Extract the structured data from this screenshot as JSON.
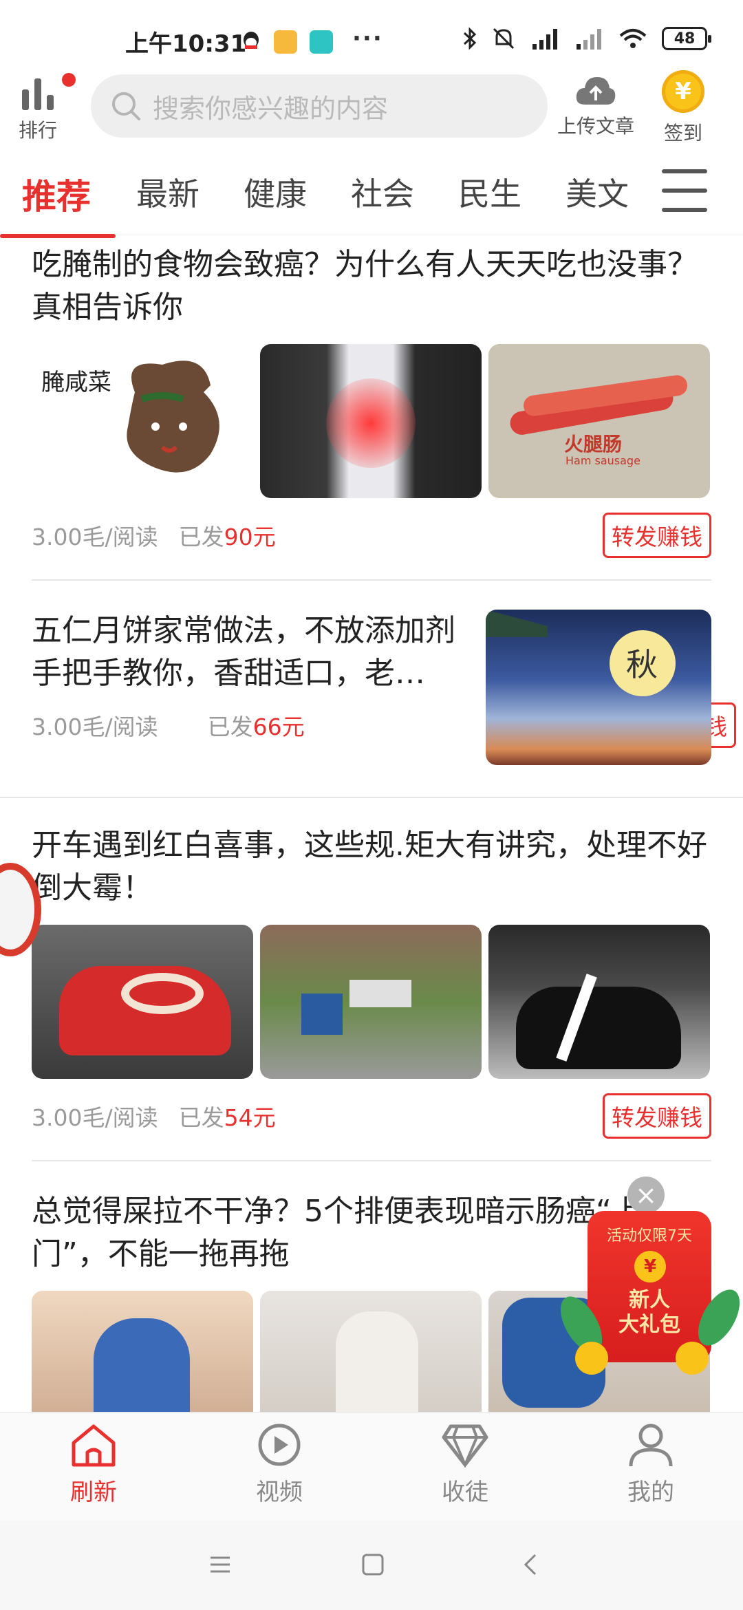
{
  "status_bar": {
    "time": "上午10:31",
    "dots": "···",
    "battery": "48"
  },
  "header": {
    "rank_label": "排行",
    "search_placeholder": "搜索你感兴趣的内容",
    "upload_label": "上传文章",
    "coin_symbol": "¥",
    "sign_label": "签到"
  },
  "tabs": [
    "推荐",
    "最新",
    "健康",
    "社会",
    "民生",
    "美文"
  ],
  "articles": [
    {
      "title": "吃腌制的食物会致癌？为什么有人天天吃也没事？真相告诉你",
      "rate": "3.00毛/阅读",
      "paid_prefix": "已发",
      "paid_amount": "90元",
      "share_label": "转发赚钱",
      "thumb_texts": [
        "腌咸菜",
        "",
        "火腿肠",
        "Ham sausage"
      ]
    },
    {
      "title": "五仁月饼家常做法，不放添加剂手把手教你，香甜适口，老…",
      "rate": "3.00毛/阅读",
      "paid_prefix": "已发",
      "paid_amount": "66元",
      "share_label": "转发赚钱",
      "thumb_texts": [
        "秋"
      ]
    },
    {
      "title": "开车遇到红白喜事，这些规.矩大有讲究，处理不好倒大霉！",
      "rate": "3.00毛/阅读",
      "paid_prefix": "已发",
      "paid_amount": "54元",
      "share_label": "转发赚钱"
    },
    {
      "title": "总觉得屎拉不干净？5个排便表现暗示肠癌“上门”，不能一拖再拖"
    }
  ],
  "promo": {
    "close": "×",
    "top": "活动仅限7天",
    "coin": "¥",
    "text_line1": "新人",
    "text_line2": "大礼包"
  },
  "bottom_nav": [
    "刷新",
    "视频",
    "收徒",
    "我的"
  ],
  "colors": {
    "accent": "#e8312e",
    "coin": "#f9c31a"
  }
}
